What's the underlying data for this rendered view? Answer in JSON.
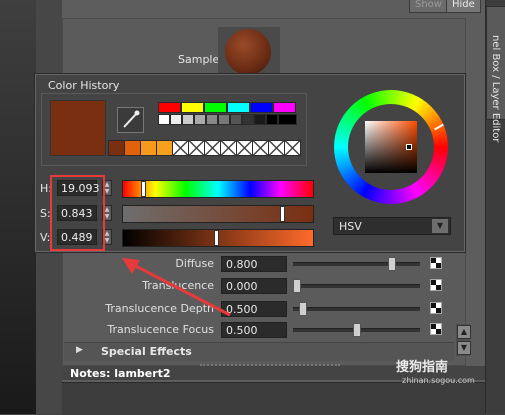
{
  "side_tab": {
    "label": "nel Box / Layer Editor"
  },
  "top_buttons": {
    "show": "Show",
    "hide": "Hide"
  },
  "sample": {
    "label": "Sample"
  },
  "color_history": {
    "title": "Color History"
  },
  "hsv": {
    "h_label": "H:",
    "h_value": "19.093",
    "s_label": "S:",
    "s_value": "0.843",
    "v_label": "V:",
    "v_value": "0.489",
    "hue_fraction": 0.053,
    "sat_fraction": 0.843,
    "val_fraction": 0.489
  },
  "mode_select": {
    "value": "HSV"
  },
  "attributes": [
    {
      "label": "Diffuse",
      "value": "0.800",
      "level": 0.8
    },
    {
      "label": "Translucence",
      "value": "0.000",
      "level": 0.0
    },
    {
      "label": "Translucence Depth",
      "value": "0.500",
      "level": 0.05
    },
    {
      "label": "Translucence Focus",
      "value": "0.500",
      "level": 0.5
    }
  ],
  "special_effects": {
    "label": "Special Effects"
  },
  "notes": {
    "label": "Notes:  lambert2"
  },
  "watermark": {
    "text": "搜狗指南",
    "url": "zhinan.sogou.com"
  },
  "colors": {
    "current_color": "#7b2f11",
    "annotation": "#e83a3a",
    "history_row1": [
      "#ff0000",
      "#ffff00",
      "#00ff00",
      "#00ffff",
      "#0000ff",
      "#ff00ff"
    ],
    "history_recent": [
      "#7b2f11",
      "#e2620c",
      "#f59a1c",
      "#f6a01c"
    ]
  },
  "icons": {
    "picker": "eyedropper-icon",
    "expand": "triangle-right-icon",
    "dropdown": "chevron-down-icon"
  }
}
